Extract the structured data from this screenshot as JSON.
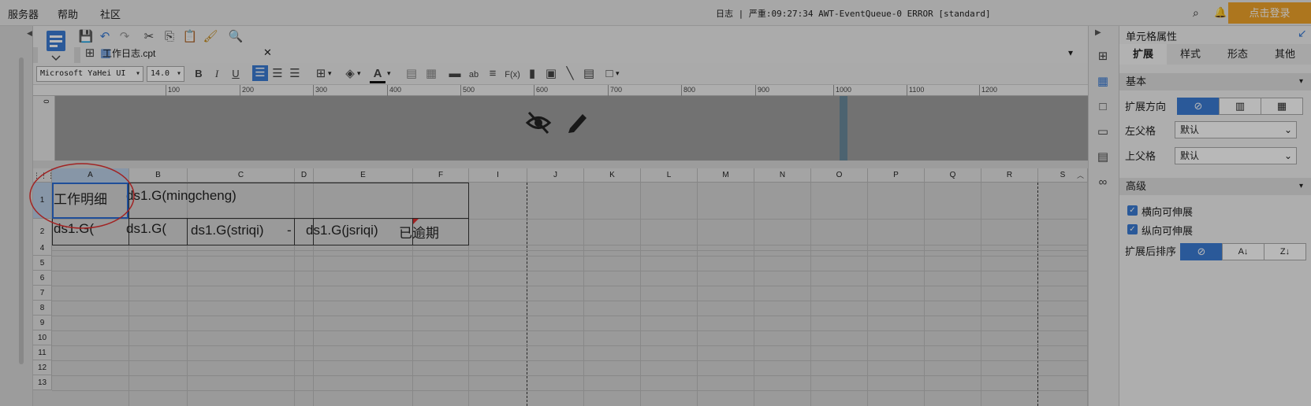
{
  "menubar": {
    "items": [
      "服务器",
      "帮助",
      "社区"
    ],
    "log": "日志 | 严重:09:27:34 AWT-EventQueue-0 ERROR [standard]",
    "login_label": "点击登录"
  },
  "toolbar": {
    "icons": [
      "save-icon",
      "undo-icon",
      "redo-icon",
      "cut-icon",
      "copy-icon",
      "paste-icon",
      "format-painter-icon",
      "preview-icon"
    ]
  },
  "tab": {
    "label": "工作日志.cpt"
  },
  "format_toolbar": {
    "font_name": "Microsoft YaHei UI",
    "font_size": "14.0",
    "bold": "B",
    "italic": "I",
    "underline": "U",
    "text_ab": "ab",
    "formula": "F(x)"
  },
  "ruler": {
    "ticks": [
      "0",
      "100",
      "200",
      "300",
      "400",
      "500",
      "600",
      "700",
      "800",
      "900",
      "1000",
      "1100",
      "1200"
    ]
  },
  "grid": {
    "columns": [
      "A",
      "B",
      "C",
      "D",
      "E",
      "F",
      "I",
      "J",
      "K",
      "L",
      "M",
      "N",
      "O",
      "P",
      "Q",
      "R",
      "S"
    ],
    "rows": [
      "1",
      "2",
      "4",
      "5",
      "6",
      "7",
      "8",
      "9",
      "10",
      "11",
      "12",
      "13"
    ],
    "cells": {
      "a1": "工作明细",
      "b1": "ds1.G(mingcheng)",
      "a2": "ds1.G(",
      "b2": "ds1.G(",
      "c2": "ds1.G(striqi)",
      "d2": "-",
      "e2": "ds1.G(jsriqi)",
      "f2": "已逾期"
    }
  },
  "panel": {
    "title": "单元格属性",
    "tabs": [
      "扩展",
      "样式",
      "形态",
      "其他"
    ],
    "basic_section": "基本",
    "expand_direction_label": "扩展方向",
    "left_parent_label": "左父格",
    "left_parent_value": "默认",
    "top_parent_label": "上父格",
    "top_parent_value": "默认",
    "advanced_section": "高级",
    "horizontal_expand": "横向可伸展",
    "vertical_expand": "纵向可伸展",
    "sort_label": "扩展后排序"
  },
  "colors": {
    "accent": "#3a7bd5",
    "login": "#f0a42a",
    "annotation": "#e03030"
  }
}
